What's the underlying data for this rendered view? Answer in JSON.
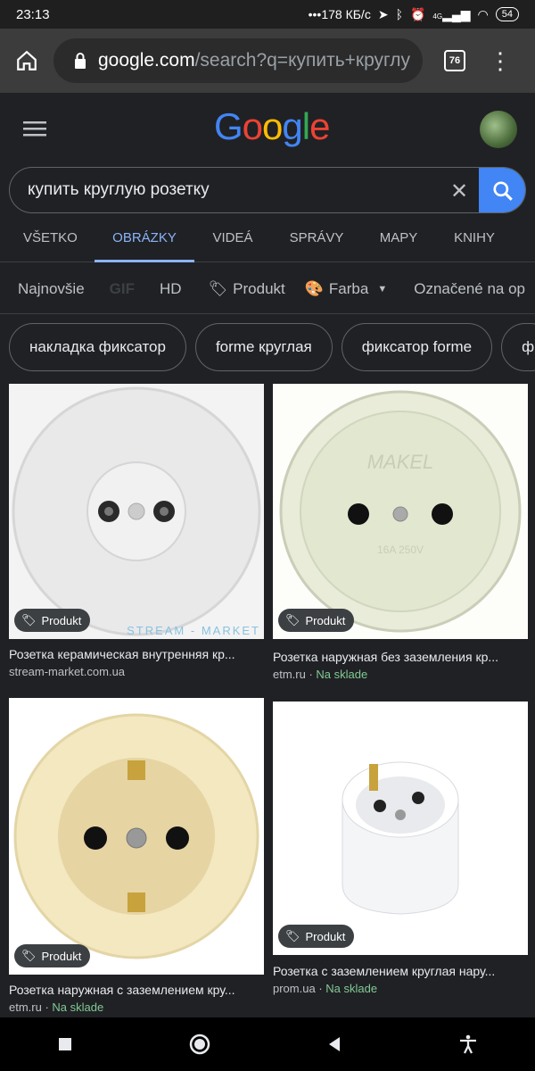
{
  "status": {
    "time": "23:13",
    "speed": "178 КБ/с",
    "network": "4G",
    "battery": "54"
  },
  "browser": {
    "url_domain": "google.com",
    "url_path": "/search?q=купить+круглу",
    "tab_count": "76"
  },
  "search": {
    "query": "купить круглую розетку"
  },
  "tabs": [
    {
      "label": "VŠETKO"
    },
    {
      "label": "OBRÁZKY"
    },
    {
      "label": "VIDEÁ"
    },
    {
      "label": "SPRÁVY"
    },
    {
      "label": "MAPY"
    },
    {
      "label": "KNIHY"
    }
  ],
  "filters": {
    "newest": "Najnovšie",
    "gif": "GIF",
    "hd": "HD",
    "product": "Produkt",
    "color": "Farba",
    "labeled": "Označené na op"
  },
  "chips": [
    "накладка фиксатор",
    "forme круглая",
    "фиксатор forme",
    "ф"
  ],
  "results": [
    {
      "title": "Розетка керамическая внутренняя кр...",
      "source": "stream-market.com.ua",
      "stock": "",
      "badge": "Produkt",
      "watermark": "STREAM - MARKET"
    },
    {
      "title": "Розетка наружная без заземления кр...",
      "source": "etm.ru",
      "stock": "Na sklade",
      "badge": "Produkt",
      "watermark": ""
    },
    {
      "title": "Розетка наружная с заземлением кру...",
      "source": "etm.ru",
      "stock": "Na sklade",
      "badge": "Produkt",
      "watermark": ""
    },
    {
      "title": "Розетка с заземлением круглая нару...",
      "source": "prom.ua",
      "stock": "Na sklade",
      "badge": "Produkt",
      "watermark": ""
    }
  ],
  "colors": {
    "accent": "#8ab4f8",
    "google_blue": "#4285f4",
    "in_stock": "#81c995",
    "background": "#202124"
  }
}
